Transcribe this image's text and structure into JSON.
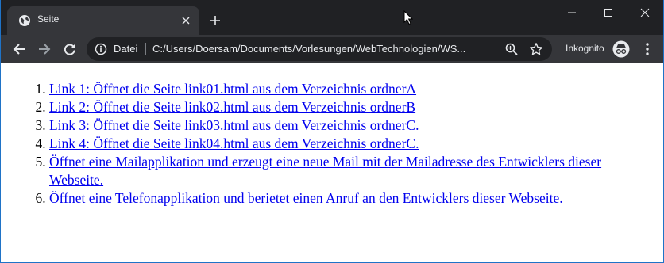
{
  "browser": {
    "tab": {
      "title": "Seite",
      "favicon": "globe-icon"
    },
    "new_tab_icon": "plus-icon",
    "window_controls": [
      "minimize-icon",
      "maximize-icon",
      "close-icon"
    ],
    "toolbar": {
      "back_icon": "arrow-left-icon",
      "forward_icon": "arrow-right-icon",
      "reload_icon": "reload-icon",
      "scheme_label": "Datei",
      "url": "C:/Users/Doersam/Documents/Vorlesungen/WebTechnologien/WS...",
      "incognito_label": "Inkognito"
    }
  },
  "page": {
    "list": [
      {
        "number": "1.",
        "text": "Link 1: Öffnet die Seite link01.html aus dem Verzeichnis ordnerA"
      },
      {
        "number": "2.",
        "text": "Link 2: Öffnet die Seite link02.html aus dem Verzeichnis ordnerB"
      },
      {
        "number": "3.",
        "text": "Link 3: Öffnet die Seite link03.html aus dem Verzeichnis ordnerC."
      },
      {
        "number": "4.",
        "text": "Link 4: Öffnet die Seite link04.html aus dem Verzeichnis ordnerC."
      },
      {
        "number": "5.",
        "text": "Öffnet eine Mailapplikation und erzeugt eine neue Mail mit der Mailadresse des Entwicklers dieser Webseite."
      },
      {
        "number": "6.",
        "text": "Öffnet eine Telefonapplikation und berietet einen Anruf an den Entwicklers dieser Webseite."
      }
    ]
  },
  "colors": {
    "titlebar": "#202124",
    "toolbar": "#35363a",
    "link": "#0000ee",
    "window_border": "#1f73c7"
  }
}
